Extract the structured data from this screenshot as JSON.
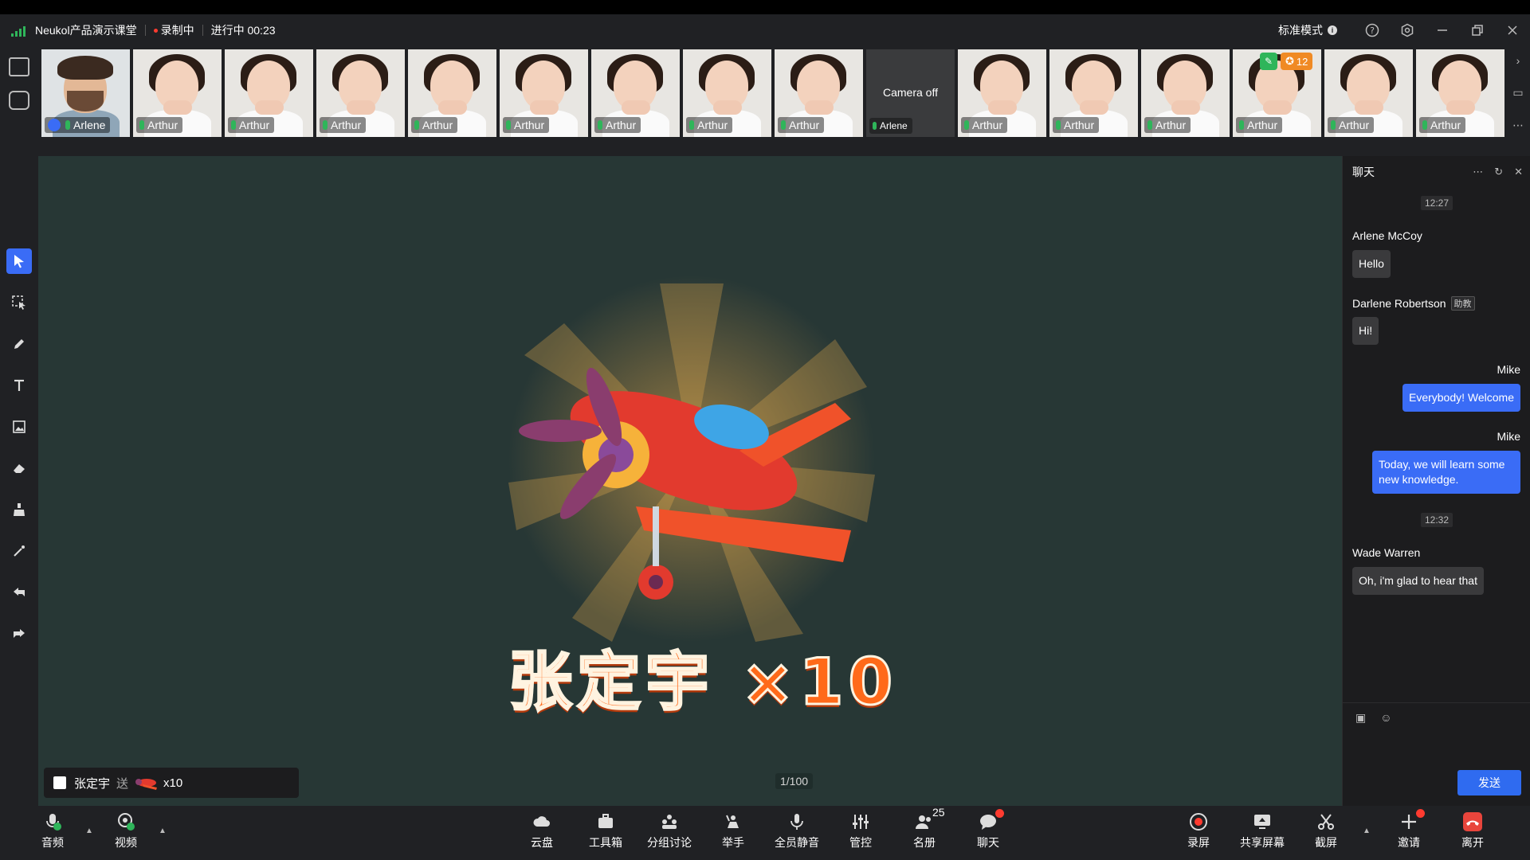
{
  "titlebar": {
    "app_title": "Neukol产品演示课堂",
    "recording": "录制中",
    "status": "进行中 00:23",
    "mode": "标准模式",
    "mode_info": "i"
  },
  "participants": [
    {
      "name": "Arlene",
      "kind": "host"
    },
    {
      "name": "Arthur",
      "kind": "student"
    },
    {
      "name": "Arthur",
      "kind": "student"
    },
    {
      "name": "Arthur",
      "kind": "student"
    },
    {
      "name": "Arthur",
      "kind": "student"
    },
    {
      "name": "Arthur",
      "kind": "student"
    },
    {
      "name": "Arthur",
      "kind": "student"
    },
    {
      "name": "Arthur",
      "kind": "student"
    },
    {
      "name": "Arthur",
      "kind": "student"
    },
    {
      "name": "Arlene",
      "kind": "camera-off",
      "off_text": "Camera off"
    },
    {
      "name": "Arthur",
      "kind": "student"
    },
    {
      "name": "Arthur",
      "kind": "student"
    },
    {
      "name": "Arthur",
      "kind": "student"
    },
    {
      "name": "Arthur",
      "kind": "student",
      "reward_count": "12"
    },
    {
      "name": "Arthur",
      "kind": "student"
    },
    {
      "name": "Arthur",
      "kind": "student"
    }
  ],
  "stage": {
    "reward_text": "张定宇 ×10",
    "page": "1/100",
    "gift_bar": {
      "sender": "张定宇",
      "verb": "送",
      "count": "x10"
    }
  },
  "chat": {
    "title": "聊天",
    "messages": [
      {
        "type": "time",
        "text": "12:27"
      },
      {
        "type": "msg",
        "sender": "Arlene McCoy",
        "text": "Hello",
        "mine": false
      },
      {
        "type": "msg",
        "sender": "Darlene Robertson",
        "role": "助教",
        "text": "Hi!",
        "mine": false
      },
      {
        "type": "msg",
        "sender": "Mike",
        "text": "Everybody! Welcome",
        "mine": true
      },
      {
        "type": "msg",
        "sender": "Mike",
        "text": "Today, we will learn some new knowledge.",
        "mine": true
      },
      {
        "type": "time",
        "text": "12:32"
      },
      {
        "type": "msg",
        "sender": "Wade Warren",
        "text": "Oh, i'm glad to hear that",
        "mine": false
      }
    ],
    "send_label": "发送"
  },
  "toolbar": {
    "audio": "音频",
    "video": "视频",
    "cloud": "云盘",
    "toolbox": "工具箱",
    "breakout": "分组讨论",
    "raise_hand": "举手",
    "mute_all": "全员静音",
    "control": "管控",
    "roster": "名册",
    "roster_count": "25",
    "chat": "聊天",
    "record": "录屏",
    "share": "共享屏幕",
    "screenshot": "截屏",
    "invite": "邀请",
    "leave": "离开"
  },
  "colors": {
    "accent": "#3a6cf6",
    "stage_bg": "#273735",
    "mic_green": "#2fb55a",
    "leave_red": "#e8453c",
    "reward_orange": "#ff6a1a"
  }
}
